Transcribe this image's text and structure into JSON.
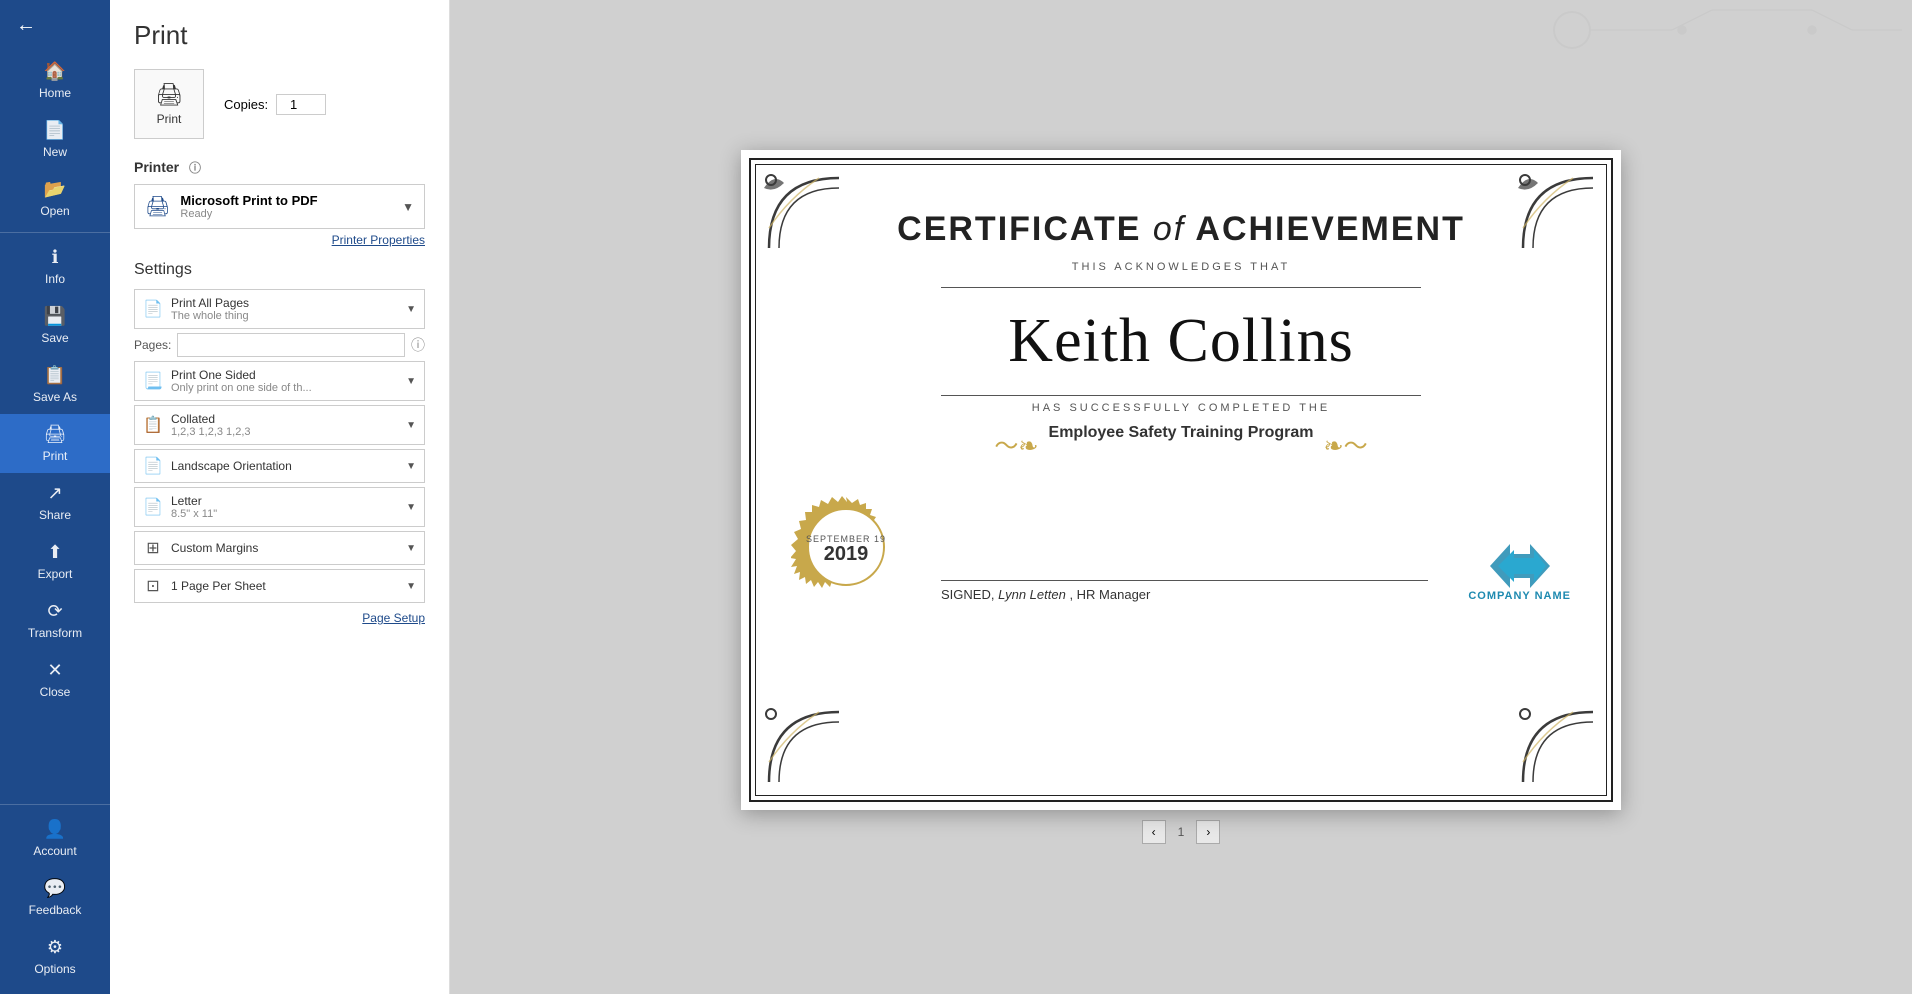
{
  "sidebar": {
    "back_icon": "←",
    "items": [
      {
        "id": "home",
        "label": "Home",
        "icon": "🏠"
      },
      {
        "id": "new",
        "label": "New",
        "icon": "📄"
      },
      {
        "id": "open",
        "label": "Open",
        "icon": "📂"
      },
      {
        "id": "info",
        "label": "Info",
        "icon": "ℹ"
      },
      {
        "id": "save",
        "label": "Save",
        "icon": "💾"
      },
      {
        "id": "save-as",
        "label": "Save As",
        "icon": "📋"
      },
      {
        "id": "print",
        "label": "Print",
        "icon": "🖨",
        "active": true
      },
      {
        "id": "share",
        "label": "Share",
        "icon": "↗"
      },
      {
        "id": "export",
        "label": "Export",
        "icon": "⬆"
      },
      {
        "id": "transform",
        "label": "Transform",
        "icon": "⟳"
      },
      {
        "id": "close",
        "label": "Close",
        "icon": "✕"
      }
    ],
    "bottom_items": [
      {
        "id": "account",
        "label": "Account",
        "icon": "👤"
      },
      {
        "id": "feedback",
        "label": "Feedback",
        "icon": "💬"
      },
      {
        "id": "options",
        "label": "Options",
        "icon": "⚙"
      }
    ]
  },
  "print": {
    "title": "Print",
    "copies_label": "Copies:",
    "copies_value": "1",
    "print_button_label": "Print",
    "printer_section": "Printer",
    "printer_name": "Microsoft Print to PDF",
    "printer_status": "Ready",
    "printer_properties": "Printer Properties",
    "settings_section": "Settings",
    "pages_label": "Pages:",
    "pages_placeholder": "",
    "print_range_main": "Print All Pages",
    "print_range_sub": "The whole thing",
    "sides_main": "Print One Sided",
    "sides_sub": "Only print on one side of th...",
    "collation_main": "Collated",
    "collation_sub": "1,2,3   1,2,3   1,2,3",
    "orientation_main": "Landscape Orientation",
    "orientation_sub": "",
    "paper_main": "Letter",
    "paper_sub": "8.5\" x 11\"",
    "margins_main": "Custom Margins",
    "margins_sub": "",
    "pages_per_sheet_main": "1 Page Per Sheet",
    "pages_per_sheet_sub": "",
    "page_setup": "Page Setup"
  },
  "certificate": {
    "title_part1": "CERTIFICATE ",
    "title_italic": "of",
    "title_part2": " ACHIEVEMENT",
    "acknowledges": "THIS ACKNOWLEDGES THAT",
    "recipient": "Keith Collins",
    "completed": "HAS SUCCESSFULLY COMPLETED THE",
    "program": "Employee Safety Training Program",
    "seal_month": "SEPTEMBER 19",
    "seal_year": "2019",
    "signed_label": "SIGNED,",
    "signed_name": "Lynn Letten",
    "signed_title": ", HR Manager",
    "logo_text": "COMPANY NAME"
  },
  "preview": {
    "page_label": "1",
    "total_pages": "1"
  }
}
